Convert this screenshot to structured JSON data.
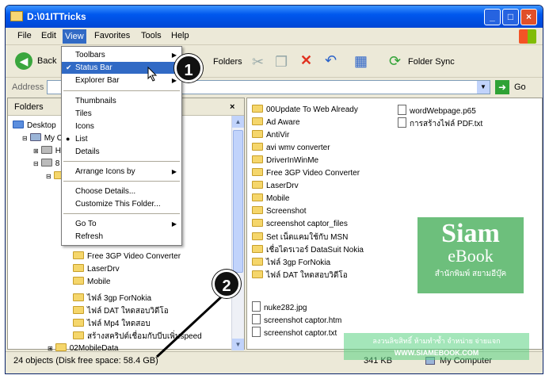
{
  "window": {
    "title": "D:\\01ITTricks",
    "controls": {
      "minimize": "_",
      "maximize": "□",
      "close": "×"
    }
  },
  "menubar": {
    "items": [
      "File",
      "Edit",
      "View",
      "Favorites",
      "Tools",
      "Help"
    ],
    "active": "View"
  },
  "toolbar": {
    "back": "Back",
    "folders": "Folders",
    "folder_sync": "Folder Sync"
  },
  "address": {
    "label": "Address",
    "go": "Go"
  },
  "left_pane": {
    "header": "Folders",
    "close": "×",
    "tree": [
      "Desktop",
      "My C",
      "H",
      "8",
      "Free 3GP Video Converter",
      "LaserDrv",
      "Mobile",
      "ไฟล์ 3gp ForNokia",
      "ไฟล์ DAT ใหดสอบวิดีโอ",
      "ไฟล์ Mp4 ใหดสอบ",
      "สร้างสคริปต์เชื่อมกับบีบเพิ่มspeed",
      "02MobileData"
    ]
  },
  "view_menu": {
    "items": [
      {
        "label": "Toolbars",
        "submenu": true
      },
      {
        "label": "Status Bar",
        "checked": true,
        "highlighted": true
      },
      {
        "label": "Explorer Bar",
        "submenu": true
      },
      {
        "label": "Thumbnails"
      },
      {
        "label": "Tiles"
      },
      {
        "label": "Icons"
      },
      {
        "label": "List",
        "selected": true
      },
      {
        "label": "Details"
      },
      {
        "label": "Arrange Icons by",
        "submenu": true
      },
      {
        "label": "Choose Details..."
      },
      {
        "label": "Customize This Folder..."
      },
      {
        "label": "Go To",
        "submenu": true
      },
      {
        "label": "Refresh"
      }
    ]
  },
  "right_pane": {
    "folders": [
      "00Update To Web Already",
      "Ad Aware",
      "AntiVir",
      "avi wmv converter",
      "DriverInWinMe",
      "Free 3GP Video Converter",
      "LaserDrv",
      "Mobile",
      "Screenshot",
      "screenshot captor_files",
      "Set เน็ตแคมใช้กับ MSN",
      "เชื่อไดรเวอร์ DataSuit Nokia",
      "ไฟล์ 3gp ForNokia",
      "ไฟล์ DAT ใหดสอบวิดีโอ"
    ],
    "files_col1": [
      "nuke282.jpg",
      "screenshot captor.htm",
      "screenshot captor.txt"
    ],
    "files_col2": [
      "wordWebpage.p65",
      "การสร้างไฟล์ PDF.txt"
    ]
  },
  "statusbar": {
    "objects": "24 objects (Disk free space: 58.4 GB)",
    "size": "341 KB",
    "location": "My Computer"
  },
  "callouts": [
    "1",
    "2"
  ],
  "watermark": {
    "brand_top": "Siam",
    "brand_bottom": "eBook",
    "brand_thai": "สำนักพิมพ์ สยามอีบุ๊ค",
    "line1": "ลงวนลิขสิทธิ์ ห้ามทำซ้ำ จำหน่าย จ่ายแจก",
    "line2": "WWW.SIAMEBOOK.COM"
  },
  "colors": {
    "titlebar": "#0058ee",
    "highlight": "#316ac5",
    "watermark": "#3caa50"
  }
}
